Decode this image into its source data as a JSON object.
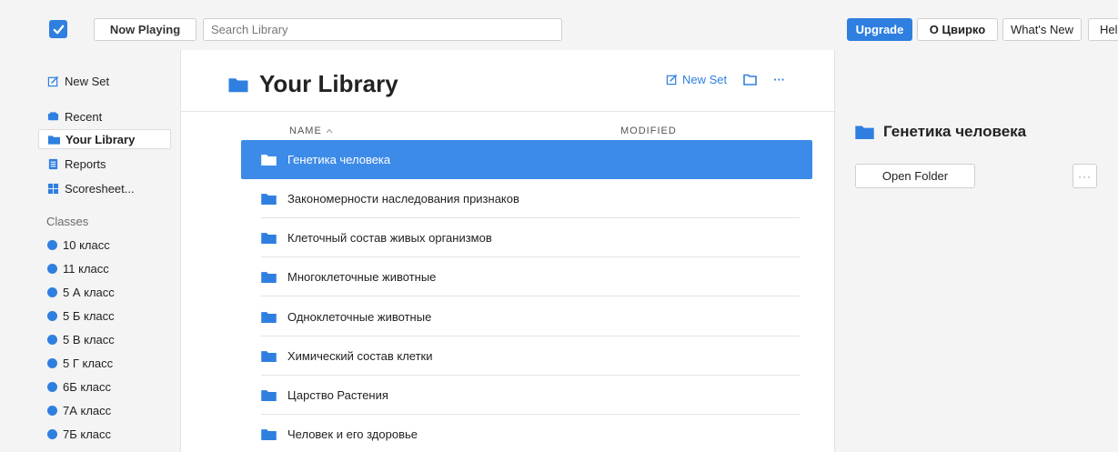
{
  "colors": {
    "accent": "#2f7fe0",
    "selected_row": "#3d8be8",
    "background": "#f4f4f4"
  },
  "toolbar": {
    "logo_icon": "checkbox-logo-icon",
    "now_playing_label": "Now Playing",
    "search_placeholder": "Search Library",
    "upgrade_label": "Upgrade",
    "user_label": "О Цвирко",
    "whats_new_label": "What's New",
    "help_label": "Help"
  },
  "sidebar": {
    "new_set_label": "New Set",
    "nav": [
      {
        "label": "Recent",
        "icon": "recent-icon"
      },
      {
        "label": "Your Library",
        "icon": "folder-icon",
        "active": true
      },
      {
        "label": "Reports",
        "icon": "reports-icon"
      },
      {
        "label": "Scoresheet...",
        "icon": "scoresheet-icon"
      }
    ],
    "classes_heading": "Classes",
    "classes": [
      "10 класс",
      "11 класс",
      "5 А класс",
      "5 Б класс",
      "5 В класс",
      "5 Г класс",
      "6Б класс",
      "7А класс",
      "7Б класс"
    ]
  },
  "main": {
    "title": "Your Library",
    "new_set_label": "New Set",
    "more_label": "···",
    "columns": {
      "name": "NAME",
      "modified": "MODIFIED"
    },
    "rows": [
      {
        "name": "Генетика человека",
        "selected": true
      },
      {
        "name": "Закономерности наследования признаков"
      },
      {
        "name": "Клеточный состав живых организмов"
      },
      {
        "name": "Многоклеточные животные"
      },
      {
        "name": "Одноклеточные животные"
      },
      {
        "name": "Химический состав клетки"
      },
      {
        "name": "Царство Растения"
      },
      {
        "name": "Человек и его здоровье"
      }
    ]
  },
  "details": {
    "title": "Генетика человека",
    "open_folder_label": "Open Folder",
    "more_label": "···"
  }
}
